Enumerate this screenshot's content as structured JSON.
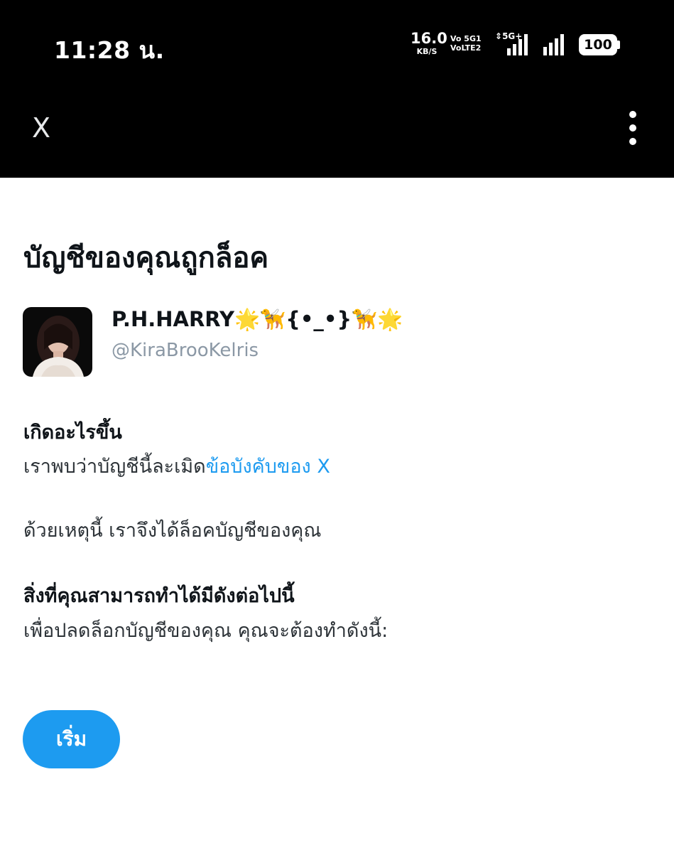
{
  "status_bar": {
    "time": "11:28 น.",
    "net_speed": "16.0",
    "net_unit": "KB/S",
    "volte_line1": "Vo 5G1",
    "volte_line2": "VoLTE2",
    "five_g": "5G+",
    "battery": "100"
  },
  "app_bar": {
    "close_label": "X"
  },
  "page": {
    "title": "บัญชีของคุณถูกล็อค"
  },
  "account": {
    "display_name": "P.H.HARRY🌟🦮{•_•}🦮🌟",
    "handle": "@KiraBrooKelris"
  },
  "what_happened": {
    "title": "เกิดอะไรขึ้น",
    "text_prefix": "เราพบว่าบัญชีนี้ละเมิด",
    "rules_link": "ข้อบังคับของ X",
    "reason": "ด้วยเหตุนี้ เราจึงได้ล็อคบัญชีของคุณ"
  },
  "what_you_can_do": {
    "title": "สิ่งที่คุณสามารถทำได้มีดังต่อไปนี้",
    "text": "เพื่อปลดล็อกบัญชีของคุณ คุณจะต้องทำดังนี้:"
  },
  "actions": {
    "start_label": "เริ่ม"
  },
  "colors": {
    "accent": "#1d9bf0",
    "bar_background": "#000000",
    "handle": "#8b98a5"
  }
}
